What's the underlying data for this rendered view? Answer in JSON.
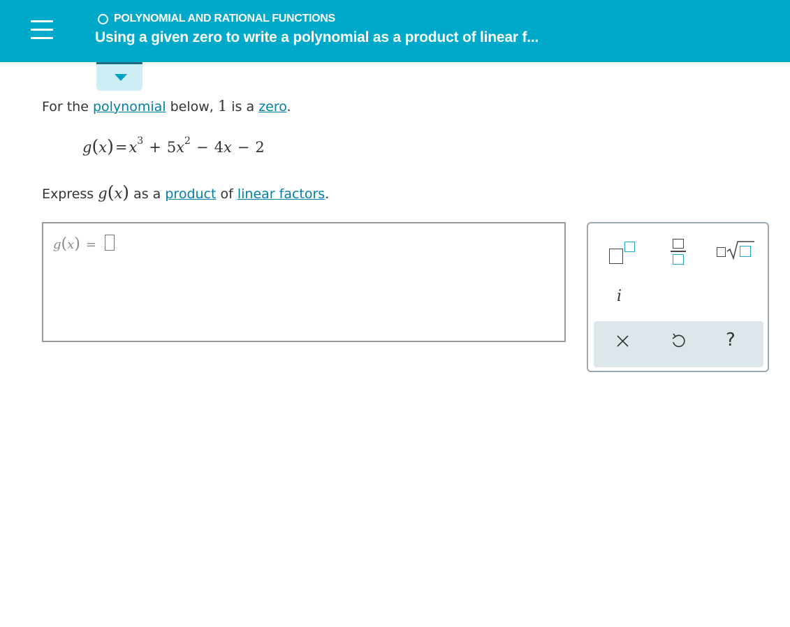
{
  "header": {
    "topic": "POLYNOMIAL AND RATIONAL FUNCTIONS",
    "title": "Using a given zero to write a polynomial as a product of linear f..."
  },
  "question": {
    "line1": {
      "t1": "For the ",
      "link_polynomial": "polynomial",
      "t2": " below, ",
      "zero_value": "1",
      "t3": " is a ",
      "link_zero": "zero",
      "t4": "."
    },
    "equation": {
      "func": "g",
      "var": "x",
      "equals": "=",
      "term1_var": "x",
      "term1_exp": "3",
      "op1": "+",
      "term2_coef": "5",
      "term2_var": "x",
      "term2_exp": "2",
      "op2": "−",
      "term3_coef": "4",
      "term3_var": "x",
      "op3": "−",
      "term4": "2"
    },
    "line2": {
      "t1": "Express ",
      "func": "g",
      "var": "x",
      "t2": " as a ",
      "link_product": "product",
      "t3": " of ",
      "link_linear_factors": "linear factors",
      "t4": "."
    }
  },
  "answer": {
    "func": "g",
    "var": "x",
    "equals": "="
  },
  "toolbox": {
    "imaginary_label": "i",
    "help_label": "?"
  },
  "colors": {
    "header_bg": "#00a9c9",
    "link": "#007fa8",
    "tool_accent": "#22a8c6",
    "toolbar_row_bg": "#dde6ea"
  }
}
